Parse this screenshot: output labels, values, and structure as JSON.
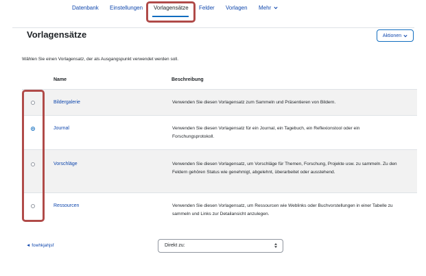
{
  "nav": {
    "items": [
      {
        "label": "Datenbank"
      },
      {
        "label": "Einstellungen"
      },
      {
        "label": "Vorlagensätze",
        "active": true
      },
      {
        "label": "Felder"
      },
      {
        "label": "Vorlagen"
      },
      {
        "label": "Mehr"
      }
    ],
    "more_icon": "chevron-down-icon"
  },
  "page": {
    "title": "Vorlagensätze",
    "actions_label": "Aktionen",
    "intro": "Wählen Sie einen Vorlagensatz, der als Ausgangspunkt verwendet werden soll."
  },
  "table": {
    "headers": {
      "name": "Name",
      "description": "Beschreibung"
    },
    "rows": [
      {
        "name": "Bildergalerie",
        "description": "Verwenden Sie diesen Vorlagensatz zum Sammeln und Präsentieren von Bildern.",
        "selected": false
      },
      {
        "name": "Journal",
        "description": "Verwenden Sie diesen Vorlagensatz für ein Journal, ein Tagebuch, ein Reflexionstool oder ein Forschungsprotokoll.",
        "selected": true
      },
      {
        "name": "Vorschläge",
        "description": "Verwenden Sie diesen Vorlagensatz, um Vorschläge für Themen, Forschung, Projekte usw. zu sammeln. Zu den Feldern gehören Status wie genehmigt, abgelehnt, überarbeitet oder ausstehend.",
        "selected": false
      },
      {
        "name": "Ressourcen",
        "description": "Verwenden Sie diesen Vorlagensatz, um Ressourcen wie Weblinks oder Buchvorstellungen in einer Tabelle zu sammeln und Links zur Detailansicht anzulegen.",
        "selected": false
      }
    ]
  },
  "footer": {
    "back_link": "◄ fowhkjahjsf",
    "jump_label": "Direkt zu:",
    "jump_icon": "up-down-caret-icon"
  },
  "highlight_color": "#b04a48",
  "accent_color": "#0f6cbf"
}
